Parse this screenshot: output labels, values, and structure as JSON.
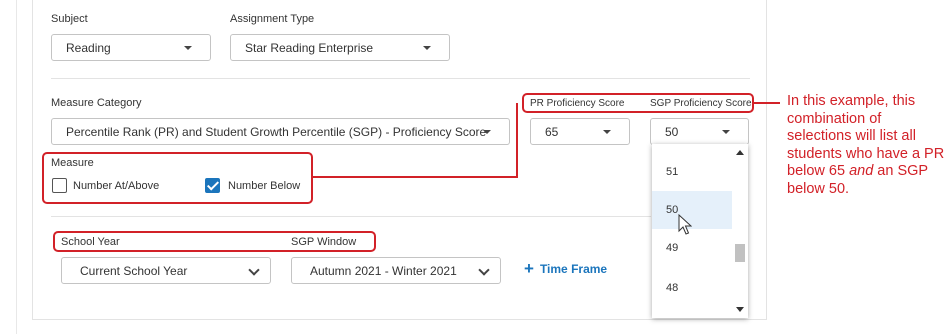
{
  "subject": {
    "label": "Subject",
    "value": "Reading"
  },
  "assignment_type": {
    "label": "Assignment Type",
    "value": "Star Reading Enterprise"
  },
  "measure_category": {
    "label": "Measure Category",
    "value": "Percentile Rank (PR) and Student Growth Percentile (SGP) - Proficiency Score"
  },
  "pr_proficiency": {
    "label": "PR Proficiency Score",
    "value": "65"
  },
  "sgp_proficiency": {
    "label": "SGP Proficiency Score",
    "value": "50",
    "options": [
      "51",
      "50",
      "49",
      "48"
    ],
    "hovered": "50"
  },
  "measure": {
    "label": "Measure",
    "options": [
      {
        "label": "Number At/Above",
        "checked": false
      },
      {
        "label": "Number Below",
        "checked": true
      }
    ]
  },
  "school_year": {
    "label": "School Year",
    "value": "Current School Year"
  },
  "sgp_window": {
    "label": "SGP Window",
    "value": "Autumn 2021 - Winter 2021"
  },
  "time_frame": {
    "label": "Time Frame",
    "icon": "plus-icon"
  },
  "annotation": {
    "before": "In this example, this combination of selections will list all students who have a PR below 65 ",
    "emphasis": "and",
    "after": " an SGP below 50."
  },
  "colors": {
    "accent": "#1b75bc",
    "callout": "#d22128",
    "hover": "#e5f0fa"
  }
}
